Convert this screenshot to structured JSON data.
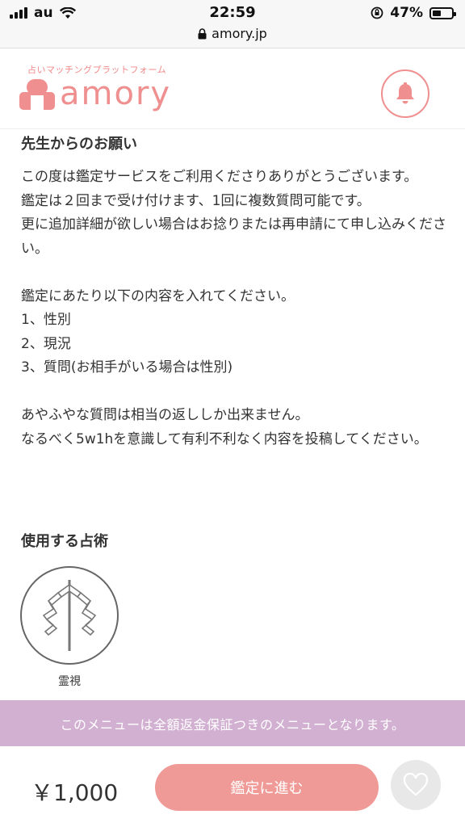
{
  "status_bar": {
    "carrier": "au",
    "time": "22:59",
    "battery": "47%",
    "battery_level": 0.47,
    "url": "amory.jp"
  },
  "header": {
    "logo_tagline": "占いマッチングプラットフォーム",
    "logo_word": "amory",
    "bell_icon": "bell-icon"
  },
  "request": {
    "title": "先生からのお願い",
    "body": "この度は鑑定サービスをご利用くださりありがとうございます。\n鑑定は２回まで受け付けます、1回に複数質問可能です。\n更に追加詳細が欲しい場合はお捻りまたは再申請にて申し込みください。\n\n鑑定にあたり以下の内容を入れてください。\n1、性別\n2、現況\n3、質問(お相手がいる場合は性別)\n\nあやふやな質問は相当の返ししか出来ません。\nなるべく5w1hを意識して有利不利なく内容を投稿してください。"
  },
  "techniques": {
    "title": "使用する占術",
    "items": [
      {
        "label": "霊視",
        "icon": "reishi-icon"
      }
    ]
  },
  "banner": {
    "text": "このメニューは全額返金保証つきのメニューとなります。"
  },
  "bottom": {
    "price": "￥1,000",
    "cta_label": "鑑定に進む",
    "favorite_icon": "heart-icon"
  },
  "colors": {
    "brand": "#ef8f8f",
    "cta": "#ef9a97",
    "banner": "#d2b0d2"
  }
}
